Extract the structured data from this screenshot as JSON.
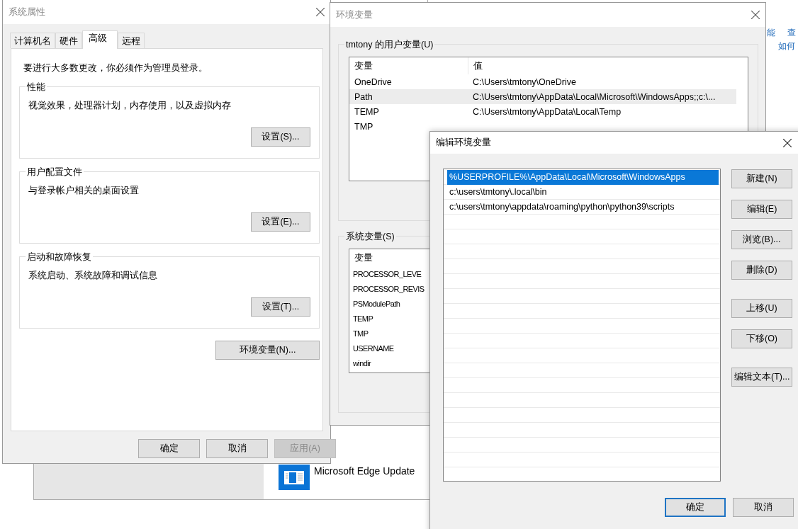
{
  "background": {
    "links": [
      {
        "text": "能"
      },
      {
        "text": "查"
      },
      {
        "text": "如何"
      }
    ],
    "app_item": {
      "name": "Microsoft Edge Update"
    }
  },
  "system_properties": {
    "title": "系统属性",
    "tabs": [
      {
        "label": "计算机名",
        "selected": false
      },
      {
        "label": "硬件",
        "selected": false
      },
      {
        "label": "高级",
        "selected": true
      },
      {
        "label": "远程",
        "selected": false
      }
    ],
    "notice": "要进行大多数更改，你必须作为管理员登录。",
    "groups": [
      {
        "title": "性能",
        "description": "视觉效果，处理器计划，内存使用，以及虚拟内存",
        "button": "设置(S)..."
      },
      {
        "title": "用户配置文件",
        "description": "与登录帐户相关的桌面设置",
        "button": "设置(E)..."
      },
      {
        "title": "启动和故障恢复",
        "description": "系统启动、系统故障和调试信息",
        "button": "设置(T)..."
      }
    ],
    "env_button": "环境变量(N)...",
    "buttons": [
      {
        "label": "确定",
        "disabled": false
      },
      {
        "label": "取消",
        "disabled": false
      },
      {
        "label": "应用(A)",
        "disabled": true
      }
    ]
  },
  "environment_variables": {
    "title": "环境变量",
    "user_group": {
      "title": "tmtony 的用户变量(U)",
      "columns": [
        "变量",
        "值"
      ],
      "rows": [
        {
          "name": "OneDrive",
          "value": "C:\\Users\\tmtony\\OneDrive",
          "selected": false
        },
        {
          "name": "Path",
          "value": "C:\\Users\\tmtony\\AppData\\Local\\Microsoft\\WindowsApps;;c:\\...",
          "selected": true
        },
        {
          "name": "TEMP",
          "value": "C:\\Users\\tmtony\\AppData\\Local\\Temp",
          "selected": false
        },
        {
          "name": "TMP",
          "selected": false
        }
      ]
    },
    "system_group": {
      "title": "系统变量(S)",
      "columns": [
        "变量"
      ],
      "rows": [
        {
          "name": "PROCESSOR_LEVE",
          "selected": false
        },
        {
          "name": "PROCESSOR_REVIS",
          "selected": false
        },
        {
          "name": "PSModulePath",
          "selected": false
        },
        {
          "name": "TEMP",
          "selected": false
        },
        {
          "name": "TMP",
          "selected": false
        },
        {
          "name": "USERNAME",
          "selected": false
        },
        {
          "name": "windir",
          "selected": false
        }
      ]
    }
  },
  "edit_dialog": {
    "title": "编辑环境变量",
    "entries": [
      {
        "text": "%USERPROFILE%\\AppData\\Local\\Microsoft\\WindowsApps",
        "selected": true
      },
      {
        "text": "c:\\users\\tmtony\\.local\\bin",
        "selected": false
      },
      {
        "text": "c:\\users\\tmtony\\appdata\\roaming\\python\\python39\\scripts",
        "selected": false
      }
    ],
    "button_groups": [
      [
        "新建(N)",
        "编辑(E)",
        "浏览(B)...",
        "删除(D)"
      ],
      [
        "上移(U)",
        "下移(O)"
      ],
      [
        "编辑文本(T)..."
      ]
    ],
    "footer_buttons": [
      {
        "label": "确定",
        "default": true
      },
      {
        "label": "取消",
        "default": false
      }
    ]
  }
}
